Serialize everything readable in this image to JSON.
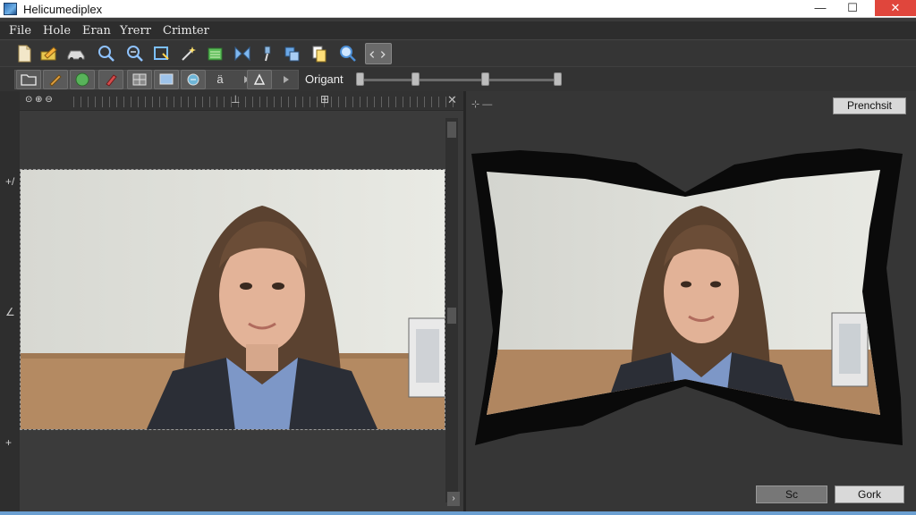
{
  "window": {
    "title": "Helicumediplex",
    "min_glyph": "—",
    "max_glyph": "☐",
    "close_glyph": "✕"
  },
  "menu": [
    "File",
    "Hole",
    "Eran",
    "Yrerr",
    "Crimter"
  ],
  "toolbar": {
    "icons": [
      "new-file-icon",
      "edit-pencil-icon",
      "car-icon",
      "zoom-icon",
      "zoom-out-icon",
      "crop-rotate-icon",
      "magic-wand-icon",
      "layers-icon",
      "flip-icon",
      "brush-icon",
      "clone-icon",
      "copy-icon",
      "search-icon",
      "code-icon"
    ]
  },
  "toolbar2": {
    "text_tool": "ä",
    "origin_label": "Origant",
    "slider_values": [
      0.0,
      0.27,
      0.63,
      1.0
    ]
  },
  "left_pane": {
    "header_icons": "⊙ ⊕ ⊖",
    "ruler_marker_a": "⊥",
    "ruler_marker_b": "⊞",
    "close_glyph": "✕",
    "side_glyphs": [
      "+/",
      "∠",
      "+"
    ],
    "scroll_right": "›"
  },
  "right_pane": {
    "header_glyph": "⊹ —",
    "preset_label": "Prenchsit",
    "button_a": "Sc",
    "button_b": "Gork"
  },
  "colors": {
    "accent_close": "#e0463c",
    "background": "#3a3a3a"
  }
}
